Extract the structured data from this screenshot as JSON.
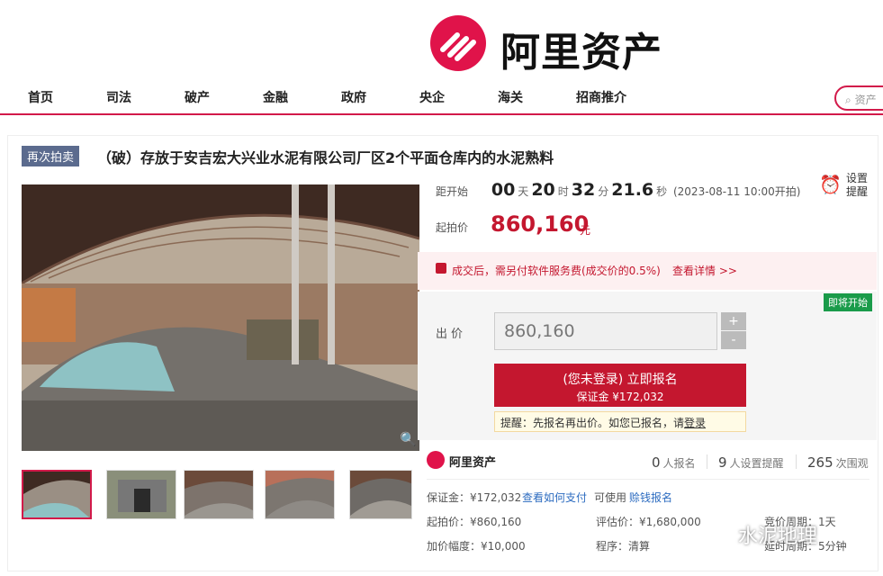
{
  "header": {
    "brand": "阿里资产",
    "search_placeholder": "资产"
  },
  "nav": [
    "首页",
    "司法",
    "破产",
    "金融",
    "政府",
    "央企",
    "海关",
    "招商推介"
  ],
  "item": {
    "badge": "再次拍卖",
    "title": "（破）存放于安吉宏大兴业水泥有限公司厂区2个平面仓库内的水泥熟料"
  },
  "countdown": {
    "label": "距开始",
    "days": "00",
    "days_unit": "天",
    "hours": "20",
    "hours_unit": "时",
    "minutes": "32",
    "minutes_unit": "分",
    "seconds": "21.6",
    "seconds_unit": "秒",
    "start_note": "(2023-08-11 10:00开拍)"
  },
  "reminder": {
    "label": "设置提醒"
  },
  "start_price": {
    "label": "起拍价",
    "value": "860,160",
    "unit": "元"
  },
  "notice": {
    "text": "成交后，需另付软件服务费(成交价的0.5%)",
    "link": "查看详情 >>"
  },
  "status_badge": "即将开始",
  "bid": {
    "label": "出价",
    "value": "860,160",
    "plus": "+",
    "minus": "-",
    "signup_main": "(您未登录) 立即报名",
    "signup_sub": "保证金 ¥172,032",
    "tip_prefix": "提醒：先报名再出价。如您已报名，请",
    "tip_link": "登录"
  },
  "stats": {
    "brand": "阿里资产",
    "signups": "0",
    "signups_label": "人报名",
    "reminders": "9",
    "reminders_label": "人设置提醒",
    "views": "265",
    "views_label": "次围观"
  },
  "details": {
    "deposit": "保证金：¥172,032",
    "deposit_link": "查看如何支付",
    "pay_note": "可使用",
    "pay_link": "赊钱报名",
    "start_price": "起拍价：¥860,160",
    "eval_price": "评估价：¥1,680,000",
    "cycle": "竞价周期：1天",
    "increment": "加价幅度：¥10,000",
    "procedure": "程序：清算",
    "delay": "延时周期：5分钟"
  },
  "watermark": "水泥地理",
  "colors": {
    "brand": "#e0134a",
    "price": "#c4172f",
    "badge_soon": "#1a9b4a",
    "link": "#2d6cc0"
  }
}
